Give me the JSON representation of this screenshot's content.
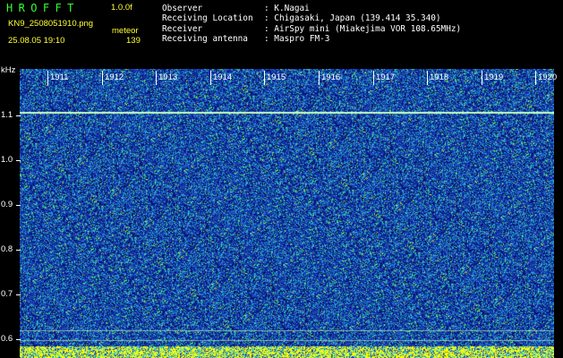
{
  "header": {
    "app_title": "HROFFT",
    "version": "1.0.0f",
    "filename": "KN9_2508051910.png",
    "datetime": "25.08.05 19:10",
    "meteor_label": "meteor",
    "meteor_count": "139"
  },
  "metadata": [
    {
      "label": "Observer",
      "value": "K.Nagai"
    },
    {
      "label": "Receiving Location",
      "value": "Chigasaki, Japan (139.414 35.340)"
    },
    {
      "label": "Receiver",
      "value": "AirSpy mini (Miakejima VOR 108.65MHz)"
    },
    {
      "label": "Receiving antenna",
      "value": "Maspro FM-3"
    }
  ],
  "spectrogram": {
    "y_unit": "kHz",
    "y_ticks": [
      "1.1",
      "1.0",
      "0.9",
      "0.8",
      "0.7",
      "0.6"
    ],
    "x_ticks": [
      "1911",
      "1912",
      "1913",
      "1914",
      "1915",
      "1916",
      "1917",
      "1918",
      "1919",
      "1920"
    ],
    "colors": {
      "background": "#1c2c9c",
      "noise_dark": "#000a5a",
      "noise_cyan": "#20b8d8",
      "noise_green": "#40e060",
      "noise_yellow": "#ffff00",
      "carrier_line": "#c8ffc0"
    }
  }
}
